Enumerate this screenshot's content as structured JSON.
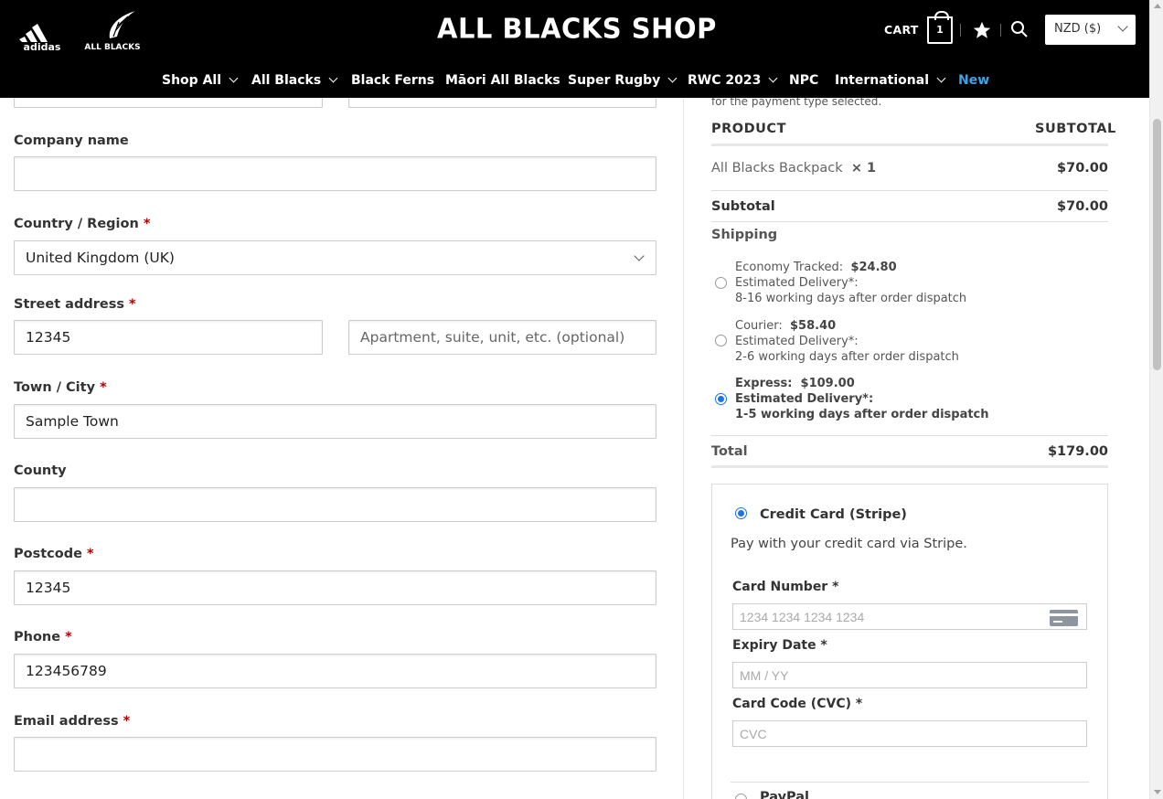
{
  "header": {
    "brand_adidas": "adidas",
    "brand_all_blacks": "ALL BLACKS",
    "shop_title": "ALL BLACKS SHOP",
    "cart_label": "CART",
    "cart_count": "1",
    "currency": "NZD ($)",
    "icons": [
      "star-icon",
      "search-icon",
      "cart-icon",
      "chevron-down-icon"
    ]
  },
  "nav": {
    "items": [
      {
        "label": "Shop All"
      },
      {
        "label": "All Blacks"
      },
      {
        "label": "Black Ferns"
      },
      {
        "label": "Māori All Blacks"
      },
      {
        "label": "Super Rugby"
      },
      {
        "label": "RWC 2023"
      },
      {
        "label": "NPC"
      },
      {
        "label": "International"
      },
      {
        "label": "New"
      }
    ],
    "accent_color": "#3ea3e6"
  },
  "billing": {
    "required_mark": "*",
    "company": {
      "label": "Company name",
      "value": ""
    },
    "country": {
      "label": "Country / Region",
      "value": "United Kingdom (UK)"
    },
    "street": {
      "label": "Street address",
      "value": "12345",
      "apt_placeholder": "Apartment, suite, unit, etc. (optional)"
    },
    "town": {
      "label": "Town / City",
      "value": "Sample Town"
    },
    "county": {
      "label": "County",
      "value": ""
    },
    "postcode": {
      "label": "Postcode",
      "value": "12345"
    },
    "phone": {
      "label": "Phone",
      "value": "123456789"
    },
    "email": {
      "label": "Email address",
      "value": ""
    }
  },
  "order": {
    "note": "for the payment type selected.",
    "col_product": "PRODUCT",
    "col_subtotal": "SUBTOTAL",
    "item_name": "All Blacks Backpack",
    "item_qty": "× 1",
    "item_price": "$70.00",
    "subtotal_label": "Subtotal",
    "subtotal_value": "$70.00",
    "shipping_label": "Shipping",
    "shipping_options": [
      {
        "name": "Economy Tracked:",
        "price": "$24.80",
        "eta_label": "Estimated Delivery*:",
        "eta": "8-16 working days after order dispatch",
        "selected": false
      },
      {
        "name": "Courier:",
        "price": "$58.40",
        "eta_label": "Estimated Delivery*:",
        "eta": "2-6 working days after order dispatch",
        "selected": false
      },
      {
        "name": "Express:",
        "price": "$109.00",
        "eta_label": "Estimated Delivery*:",
        "eta": "1-5 working days after order dispatch",
        "selected": true
      }
    ],
    "total_label": "Total",
    "total_value": "$179.00"
  },
  "payment": {
    "method_stripe": "Credit Card (Stripe)",
    "stripe_desc": "Pay with your credit card via Stripe.",
    "card_number_label": "Card Number",
    "card_number_placeholder": "1234 1234 1234 1234",
    "expiry_label": "Expiry Date",
    "expiry_placeholder": "MM / YY",
    "cvc_label": "Card Code (CVC)",
    "cvc_placeholder": "CVC",
    "method_paypal": "PayPal",
    "required_mark": "*"
  },
  "colors": {
    "header_bg": "#000000",
    "required": "#b20000",
    "radio": "#1a73e8"
  }
}
